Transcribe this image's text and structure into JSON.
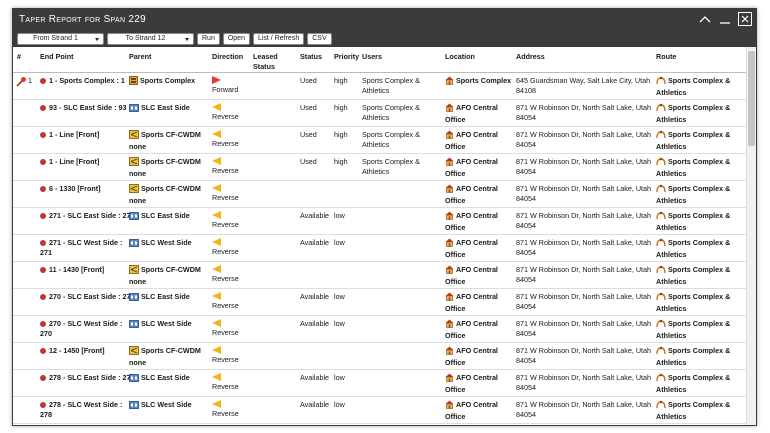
{
  "window": {
    "title": "Taper Report for Span 229"
  },
  "toolbar": {
    "from_strand": "From Strand 1",
    "to_strand": "To Strand 12",
    "run": "Run",
    "open": "Open",
    "list_refresh": "List / Refresh",
    "csv": "CSV"
  },
  "columns": {
    "num": "#",
    "end_point": "End Point",
    "parent": "Parent",
    "direction": "Direction",
    "leased_status": "Leased Status",
    "status": "Status",
    "priority": "Priority",
    "users": "Users",
    "location": "Location",
    "address": "Address",
    "route": "Route"
  },
  "rows": [
    {
      "num": "1",
      "end_point": "1 - Sports Complex : 1",
      "parent_icon": "cabinet-icon",
      "parent": "Sports Complex",
      "parent_sub": "",
      "direction": "Forward",
      "status": "Used",
      "priority": "high",
      "users": "Sports Complex & Athletics",
      "location": "Sports Complex",
      "address": "645 Guardsman Way, Salt Lake City, Utah 84108",
      "route": "Sports Complex & Athletics"
    },
    {
      "num": "",
      "end_point": "93 - SLC East Side : 93",
      "parent_icon": "panel-icon",
      "parent": "SLC East Side",
      "parent_sub": "",
      "direction": "Reverse",
      "status": "Used",
      "priority": "high",
      "users": "Sports Complex & Athletics",
      "location": "AFO Central Office",
      "address": "871 W Robinson Dr, North Salt Lake, Utah 84054",
      "route": "Sports Complex & Athletics"
    },
    {
      "num": "",
      "end_point": "1 - Line [Front]",
      "parent_icon": "splitter-icon",
      "parent": "Sports CF-CWDM",
      "parent_sub": "none",
      "direction": "Reverse",
      "status": "Used",
      "priority": "high",
      "users": "Sports Complex & Athletics",
      "location": "AFO Central Office",
      "address": "871 W Robinson Dr, North Salt Lake, Utah 84054",
      "route": "Sports Complex & Athletics"
    },
    {
      "num": "",
      "end_point": "1 - Line [Front]",
      "parent_icon": "splitter-icon",
      "parent": "Sports CF-CWDM",
      "parent_sub": "none",
      "direction": "Reverse",
      "status": "Used",
      "priority": "high",
      "users": "Sports Complex & Athletics",
      "location": "AFO Central Office",
      "address": "871 W Robinson Dr, North Salt Lake, Utah 84054",
      "route": "Sports Complex & Athletics"
    },
    {
      "num": "",
      "end_point": "6 - 1330 [Front]",
      "parent_icon": "splitter-icon",
      "parent": "Sports CF-CWDM",
      "parent_sub": "none",
      "direction": "Reverse",
      "status": "",
      "priority": "",
      "users": "",
      "location": "AFO Central Office",
      "address": "871 W Robinson Dr, North Salt Lake, Utah 84054",
      "route": "Sports Complex & Athletics"
    },
    {
      "num": "",
      "end_point": "271 - SLC East Side : 271",
      "parent_icon": "panel-icon",
      "parent": "SLC East Side",
      "parent_sub": "",
      "direction": "Reverse",
      "status": "Available",
      "priority": "low",
      "users": "",
      "location": "AFO Central Office",
      "address": "871 W Robinson Dr, North Salt Lake, Utah 84054",
      "route": "Sports Complex & Athletics"
    },
    {
      "num": "",
      "end_point": "271 - SLC West Side : 271",
      "parent_icon": "panel-icon",
      "parent": "SLC West Side",
      "parent_sub": "",
      "direction": "Reverse",
      "status": "Available",
      "priority": "low",
      "users": "",
      "location": "AFO Central Office",
      "address": "871 W Robinson Dr, North Salt Lake, Utah 84054",
      "route": "Sports Complex & Athletics"
    },
    {
      "num": "",
      "end_point": "11 - 1430 [Front]",
      "parent_icon": "splitter-icon",
      "parent": "Sports CF-CWDM",
      "parent_sub": "none",
      "direction": "Reverse",
      "status": "",
      "priority": "",
      "users": "",
      "location": "AFO Central Office",
      "address": "871 W Robinson Dr, North Salt Lake, Utah 84054",
      "route": "Sports Complex & Athletics"
    },
    {
      "num": "",
      "end_point": "270 - SLC East Side : 270",
      "parent_icon": "panel-icon",
      "parent": "SLC East Side",
      "parent_sub": "",
      "direction": "Reverse",
      "status": "Available",
      "priority": "low",
      "users": "",
      "location": "AFO Central Office",
      "address": "871 W Robinson Dr, North Salt Lake, Utah 84054",
      "route": "Sports Complex & Athletics"
    },
    {
      "num": "",
      "end_point": "270 - SLC West Side : 270",
      "parent_icon": "panel-icon",
      "parent": "SLC West Side",
      "parent_sub": "",
      "direction": "Reverse",
      "status": "Available",
      "priority": "low",
      "users": "",
      "location": "AFO Central Office",
      "address": "871 W Robinson Dr, North Salt Lake, Utah 84054",
      "route": "Sports Complex & Athletics"
    },
    {
      "num": "",
      "end_point": "12 - 1450 [Front]",
      "parent_icon": "splitter-icon",
      "parent": "Sports CF-CWDM",
      "parent_sub": "none",
      "direction": "Reverse",
      "status": "",
      "priority": "",
      "users": "",
      "location": "AFO Central Office",
      "address": "871 W Robinson Dr, North Salt Lake, Utah 84054",
      "route": "Sports Complex & Athletics"
    },
    {
      "num": "",
      "end_point": "278 - SLC East Side : 278",
      "parent_icon": "panel-icon",
      "parent": "SLC East Side",
      "parent_sub": "",
      "direction": "Reverse",
      "status": "Available",
      "priority": "low",
      "users": "",
      "location": "AFO Central Office",
      "address": "871 W Robinson Dr, North Salt Lake, Utah 84054",
      "route": "Sports Complex & Athletics"
    },
    {
      "num": "",
      "end_point": "278 - SLC West Side : 278",
      "parent_icon": "panel-icon",
      "parent": "SLC West Side",
      "parent_sub": "",
      "direction": "Reverse",
      "status": "Available",
      "priority": "low",
      "users": "",
      "location": "AFO Central Office",
      "address": "871 W Robinson Dr, North Salt Lake, Utah 84054",
      "route": "Sports Complex & Athletics"
    }
  ],
  "colors": {
    "titlebar": "#3b3b3b",
    "forward": "#e53935",
    "reverse": "#f2b61b",
    "endpoint_dot": "#c0392b"
  },
  "scroll": {
    "position": 0.0
  }
}
